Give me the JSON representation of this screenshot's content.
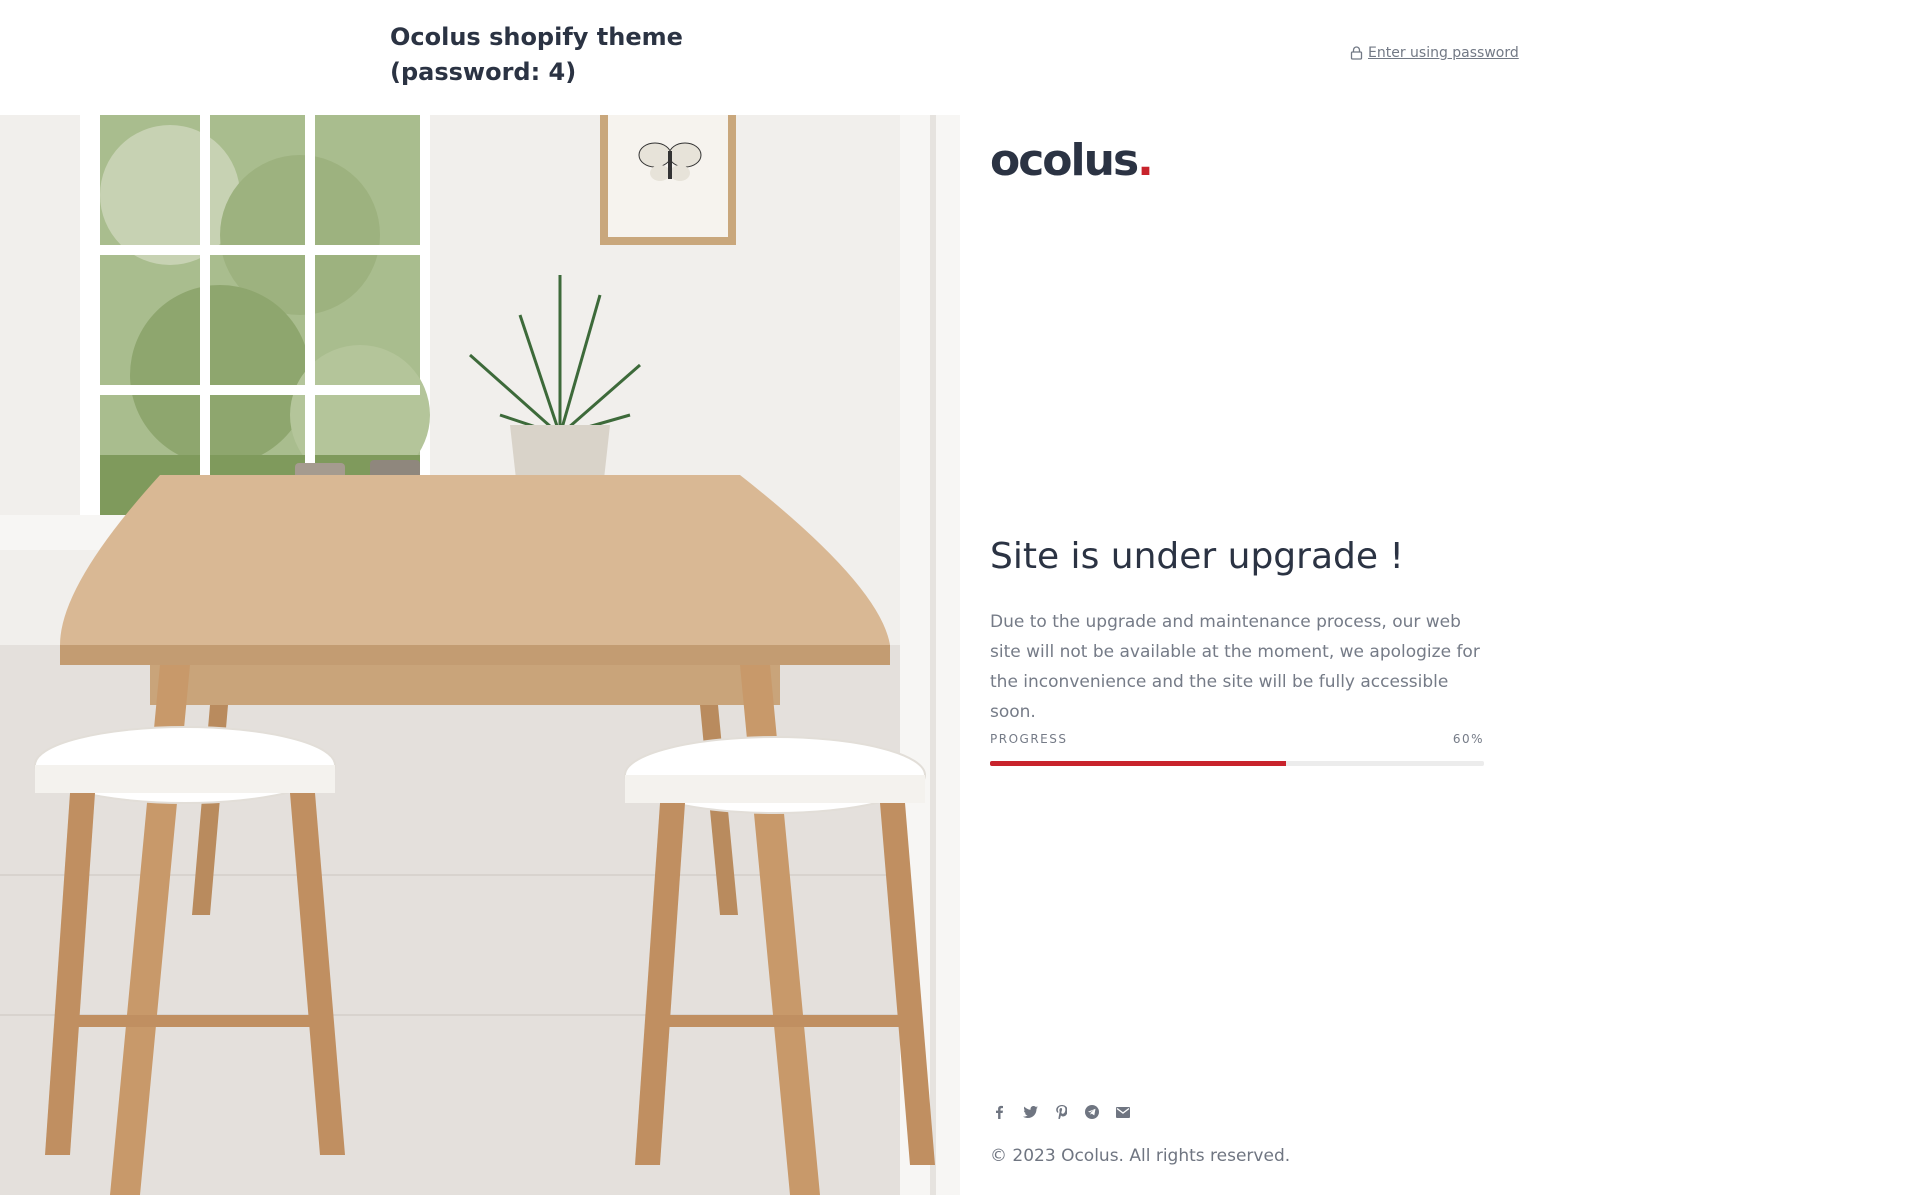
{
  "header": {
    "store_title": "Ocolus shopify theme (password: 4)",
    "password_link_label": "Enter using password",
    "lock_icon": "lock-icon"
  },
  "hero": {
    "image_description": "dining-room-image"
  },
  "main": {
    "logo_text": "ocolus",
    "logo_dot": ".",
    "headline": "Site is under upgrade !",
    "description": "Due to the upgrade and maintenance process, our web site will not be available at the moment, we apologize for the inconvenience and the site will be fully accessible soon.",
    "progress": {
      "label": "PROGRESS",
      "value_label": "60%",
      "value": 0.6
    }
  },
  "footer": {
    "social_icons": [
      "facebook-icon",
      "twitter-icon",
      "pinterest-icon",
      "telegram-icon",
      "email-icon"
    ],
    "copyright": "© 2023 Ocolus. All rights reserved."
  },
  "colors": {
    "accent": "#c8232c",
    "text_dark": "#2b3343",
    "text_muted": "#757b87",
    "track": "#ececec"
  }
}
